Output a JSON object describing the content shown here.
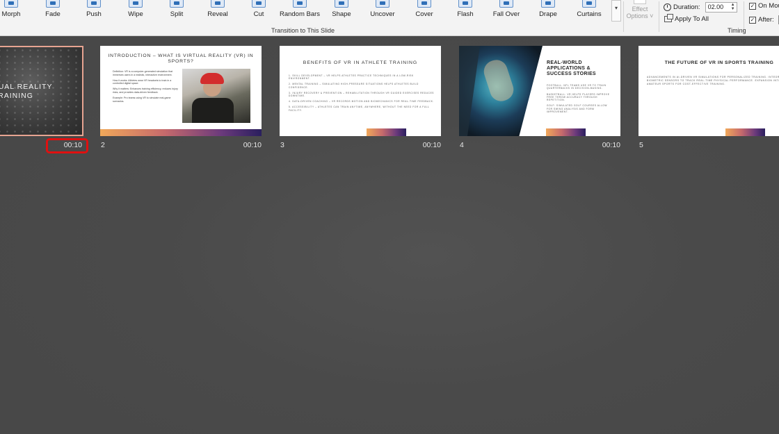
{
  "ribbon": {
    "transitions": [
      {
        "label": "Morph",
        "icon": "morph-icon"
      },
      {
        "label": "Fade",
        "icon": "fade-icon"
      },
      {
        "label": "Push",
        "icon": "push-icon"
      },
      {
        "label": "Wipe",
        "icon": "wipe-icon"
      },
      {
        "label": "Split",
        "icon": "split-icon"
      },
      {
        "label": "Reveal",
        "icon": "reveal-icon"
      },
      {
        "label": "Cut",
        "icon": "cut-icon"
      },
      {
        "label": "Random Bars",
        "icon": "random-bars-icon"
      },
      {
        "label": "Shape",
        "icon": "shape-icon"
      },
      {
        "label": "Uncover",
        "icon": "uncover-icon"
      },
      {
        "label": "Cover",
        "icon": "cover-icon"
      },
      {
        "label": "Flash",
        "icon": "flash-icon"
      },
      {
        "label": "Fall Over",
        "icon": "fall-over-icon"
      },
      {
        "label": "Drape",
        "icon": "drape-icon"
      },
      {
        "label": "Curtains",
        "icon": "curtains-icon"
      }
    ],
    "effect_options_label": "Effect Options",
    "effect_options_line1": "Effect",
    "effect_options_line2": "Options ˅",
    "group_transition_label": "Transition to This Slide",
    "timing": {
      "duration_label": "Duration:",
      "duration_value": "02.00",
      "apply_to_all_label": "Apply To All",
      "on_mouse_label": "On Mou",
      "after_label": "After:",
      "group_label": "Timing"
    }
  },
  "slides": [
    {
      "number": "",
      "time": "00:10",
      "title_line1": "IRTUAL REALITY",
      "title_line2": "E TRAINING"
    },
    {
      "number": "2",
      "time": "00:10",
      "title": "INTRODUCTION – WHAT IS VIRTUAL REALITY (VR) IN SPORTS?",
      "p1": "Definition: VR is a computer-generated simulation that immerses users in a realistic, interactive environment.",
      "p2": "How it works: Athletes wear VR headsets to train in a controlled digital space.",
      "p3": "Why it matters: Enhances training efficiency, reduces injury risks, and provides data-driven feedback.",
      "p4": "Example: Pro teams using VR to simulate real-game scenarios."
    },
    {
      "number": "3",
      "time": "00:10",
      "title": "BENEFITS OF VR IN ATHLETE TRAINING",
      "l1": "1. SKILL DEVELOPMENT – VR HELPS ATHLETES PRACTICE TECHNIQUES IN A LOW-RISK ENVIRONMENT.",
      "l2": "2. MENTAL TRAINING – SIMULATING HIGH-PRESSURE SITUATIONS HELPS ATHLETES BUILD CONFIDENCE.",
      "l3": "3. INJURY RECOVERY & PREVENTION – REHABILITATION THROUGH VR GUIDED EXERCISES REDUCES DOWNTIME.",
      "l4": "4. DATA-DRIVEN COACHING – VR RECORDS MOTION AND BIOMECHANICS FOR REAL-TIME FEEDBACK.",
      "l5": "5. ACCESSIBILITY – ATHLETES CAN TRAIN ANYTIME, ANYWHERE, WITHOUT THE NEED FOR A FULL FACILITY."
    },
    {
      "number": "4",
      "time": "00:10",
      "title_line1": "REAL-WORLD",
      "title_line2": "APPLICATIONS &",
      "title_line3": "SUCCESS STORIES",
      "l1": "FOOTBALL: NFL TEAMS USE VR TO TRAIN QUARTERBACKS IN DECISION-MAKING.",
      "l2": "BASKETBALL: VR HELPS PLAYERS IMPROVE FREE THROW ACCURACY THROUGH REPETITION.",
      "l3": "GOLF: SIMULATED GOLF COURSES ALLOW FOR SWING ANALYSIS AND FORM IMPROVEMENT."
    },
    {
      "number": "5",
      "time": "",
      "title": "THE FUTURE OF VR IN SPORTS TRAINING",
      "body": "ADVANCEMENTS IN AI-DRIVEN VR SIMULATIONS FOR PERSONALIZED TRAINING. INTEGRATION WITH BIOMETRIC SENSORS TO TRACK REAL-TIME PHYSICAL PERFORMANCE. EXPANSION INTO YOUTH AND AMATEUR SPORTS FOR COST-EFFECTIVE TRAINING."
    }
  ]
}
